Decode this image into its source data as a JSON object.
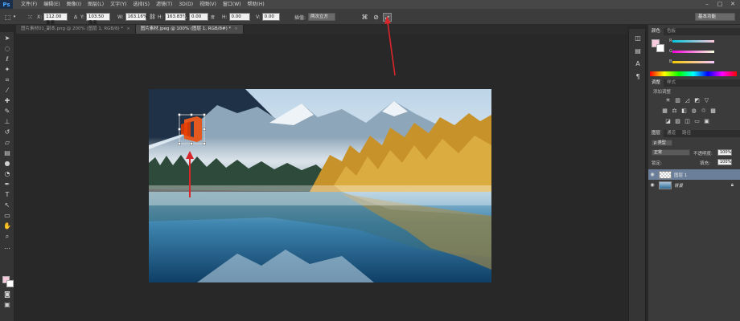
{
  "app": {
    "logo": "Ps"
  },
  "menu": [
    "文件(F)",
    "编辑(E)",
    "图像(I)",
    "图层(L)",
    "文字(Y)",
    "选择(S)",
    "滤镜(T)",
    "3D(D)",
    "视图(V)",
    "窗口(W)",
    "帮助(H)"
  ],
  "window_controls": {
    "minimize": "–",
    "maximize": "□",
    "close": "✕"
  },
  "options": {
    "x_label": "X:",
    "x_value": "112.00 像素",
    "y_label": "Y:",
    "y_value": "103.50 像素",
    "w_label": "W:",
    "w_value": "163.16%",
    "h_label": "H:",
    "h_value": "163.83%",
    "angle_label": "∆",
    "angle_value": "0.00",
    "hskew_label": "H:",
    "hskew_value": "0.00",
    "vskew_label": "V:",
    "vskew_value": "0.00",
    "interp_label": "插值:",
    "interp_value": "两次立方",
    "workspace": "基本功能"
  },
  "tabs": [
    {
      "label": "图片素材01_副本.png @ 200% (图层 1, RGB/8) *",
      "close": "×"
    },
    {
      "label": "图片素材.jpeg @ 100% (图层 1, RGB/8#) *",
      "close": "×"
    }
  ],
  "panels": {
    "color_tabs": [
      "颜色",
      "色板"
    ],
    "slider_letters": [
      "R",
      "G",
      "B"
    ],
    "adj_tabs": [
      "调整",
      "样式"
    ],
    "adj_add_label": "添加调整",
    "layers_tabs": [
      "图层",
      "通道",
      "路径"
    ],
    "kind_select": "ρ 类型",
    "blend_mode": "正常",
    "opacity_label": "不透明度:",
    "opacity_value": "100%",
    "lock_label": "锁定:",
    "fill_label": "填充:",
    "fill_value": "100%",
    "layers": [
      {
        "name": "图层 1",
        "selected": true
      },
      {
        "name": "背景",
        "selected": false
      }
    ]
  },
  "colors": {
    "foreground": "#f6c9dc",
    "background": "#ffffff",
    "annotation_arrow": "#d8262b"
  }
}
